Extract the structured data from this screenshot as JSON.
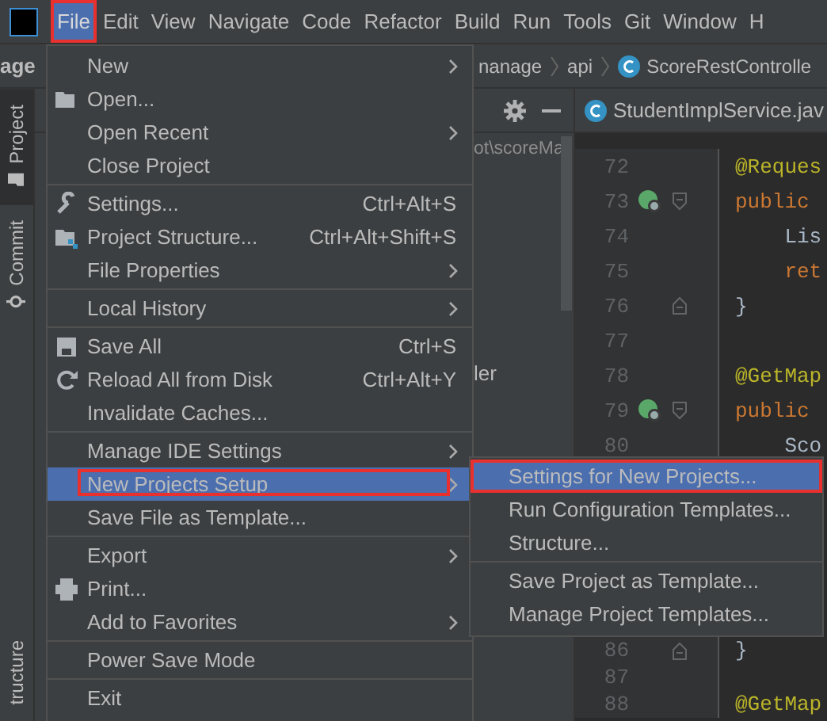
{
  "menubar": {
    "items": [
      {
        "label": "File",
        "selected": true,
        "annotated": true
      },
      {
        "label": "Edit",
        "selected": false,
        "annotated": false
      },
      {
        "label": "View",
        "selected": false,
        "annotated": false
      },
      {
        "label": "Navigate",
        "selected": false,
        "annotated": false
      },
      {
        "label": "Code",
        "selected": false,
        "annotated": false
      },
      {
        "label": "Refactor",
        "selected": false,
        "annotated": false
      },
      {
        "label": "Build",
        "selected": false,
        "annotated": false
      },
      {
        "label": "Run",
        "selected": false,
        "annotated": false
      },
      {
        "label": "Tools",
        "selected": false,
        "annotated": false
      },
      {
        "label": "Git",
        "selected": false,
        "annotated": false
      },
      {
        "label": "Window",
        "selected": false,
        "annotated": false
      },
      {
        "label": "H",
        "selected": false,
        "annotated": false
      }
    ]
  },
  "project_header": "age",
  "breadcrumbs": [
    {
      "label": "nanage",
      "kind": "folder"
    },
    {
      "label": "api",
      "kind": "folder"
    },
    {
      "label": "ScoreRestControlle",
      "kind": "class"
    }
  ],
  "side_tabs": [
    {
      "label": "Project",
      "selected": true
    },
    {
      "label": "Commit",
      "selected": false
    },
    {
      "label": "tructure",
      "selected": false
    }
  ],
  "project_tree": {
    "path": "ot\\scoreMa",
    "items": [
      {
        "label": "ler"
      }
    ]
  },
  "editor_tab": {
    "label": "StudentImplService.jav"
  },
  "code_lines": [
    {
      "number": "72",
      "text": "@Reques",
      "kind": "annotation"
    },
    {
      "number": "73",
      "text": "public ",
      "kind": "keyword"
    },
    {
      "number": "74",
      "text": "    Lis",
      "kind": "plain"
    },
    {
      "number": "75",
      "text": "    ret",
      "kind": "keyword"
    },
    {
      "number": "76",
      "text": "}",
      "kind": "plain"
    },
    {
      "number": "77",
      "kind": "plain"
    },
    {
      "number": "78",
      "text": "@GetMap",
      "kind": "annotation"
    },
    {
      "number": "79",
      "text": "public ",
      "kind": "keyword"
    },
    {
      "number": "80",
      "text": "    Sco",
      "kind": "plain"
    }
  ],
  "code_lines_below": [
    {
      "number": "86",
      "text": "}",
      "kind": "plain"
    },
    {
      "number": "87",
      "kind": "plain"
    },
    {
      "number": "88",
      "text": "@GetMap",
      "kind": "annotation"
    }
  ],
  "file_menu": {
    "items": [
      {
        "kind": "item",
        "label": "New",
        "submenu": true,
        "selected": false,
        "annotated": false
      },
      {
        "kind": "item",
        "label": "Open...",
        "submenu": false,
        "selected": false,
        "annotated": false
      },
      {
        "kind": "item",
        "label": "Open Recent",
        "submenu": true,
        "selected": false,
        "annotated": false
      },
      {
        "kind": "item",
        "label": "Close Project",
        "submenu": false,
        "selected": false,
        "annotated": false
      },
      {
        "kind": "separator"
      },
      {
        "kind": "item",
        "label": "Settings...",
        "shortcut": "Ctrl+Alt+S",
        "submenu": false,
        "selected": false,
        "annotated": false
      },
      {
        "kind": "item",
        "label": "Project Structure...",
        "shortcut": "Ctrl+Alt+Shift+S",
        "submenu": false,
        "selected": false,
        "annotated": false
      },
      {
        "kind": "item",
        "label": "File Properties",
        "submenu": true,
        "selected": false,
        "annotated": false
      },
      {
        "kind": "separator"
      },
      {
        "kind": "item",
        "label": "Local History",
        "submenu": true,
        "selected": false,
        "annotated": false
      },
      {
        "kind": "separator"
      },
      {
        "kind": "item",
        "label": "Save All",
        "shortcut": "Ctrl+S",
        "submenu": false,
        "selected": false,
        "annotated": false
      },
      {
        "kind": "item",
        "label": "Reload All from Disk",
        "shortcut": "Ctrl+Alt+Y",
        "submenu": false,
        "selected": false,
        "annotated": false
      },
      {
        "kind": "item",
        "label": "Invalidate Caches...",
        "submenu": false,
        "selected": false,
        "annotated": false
      },
      {
        "kind": "separator"
      },
      {
        "kind": "item",
        "label": "Manage IDE Settings",
        "submenu": true,
        "selected": false,
        "annotated": false
      },
      {
        "kind": "item",
        "label": "New Projects Setup",
        "submenu": true,
        "selected": true,
        "annotated": true
      },
      {
        "kind": "item",
        "label": "Save File as Template...",
        "submenu": false,
        "selected": false,
        "annotated": false
      },
      {
        "kind": "separator"
      },
      {
        "kind": "item",
        "label": "Export",
        "submenu": true,
        "selected": false,
        "annotated": false
      },
      {
        "kind": "item",
        "label": "Print...",
        "submenu": false,
        "selected": false,
        "annotated": false
      },
      {
        "kind": "item",
        "label": "Add to Favorites",
        "submenu": true,
        "selected": false,
        "annotated": false
      },
      {
        "kind": "separator"
      },
      {
        "kind": "item",
        "label": "Power Save Mode",
        "submenu": false,
        "selected": false,
        "annotated": false
      },
      {
        "kind": "separator"
      },
      {
        "kind": "item",
        "label": "Exit",
        "submenu": false,
        "selected": false,
        "annotated": false
      }
    ]
  },
  "submenu": {
    "items": [
      {
        "kind": "item",
        "label": "Settings for New Projects...",
        "selected": true,
        "annotated": true
      },
      {
        "kind": "item",
        "label": "Run Configuration Templates...",
        "selected": false,
        "annotated": false
      },
      {
        "kind": "item",
        "label": "Structure...",
        "selected": false,
        "annotated": false
      },
      {
        "kind": "separator"
      },
      {
        "kind": "item",
        "label": "Save Project as Template...",
        "selected": false,
        "annotated": false
      },
      {
        "kind": "item",
        "label": "Manage Project Templates...",
        "selected": false,
        "annotated": false
      }
    ]
  }
}
